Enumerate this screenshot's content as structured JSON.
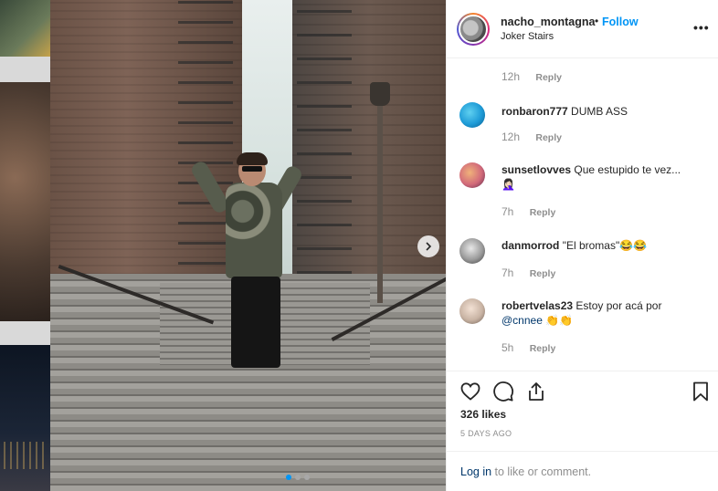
{
  "post": {
    "username": "nacho_montagna",
    "separator": "•",
    "follow_label": "Follow",
    "location": "Joker Stairs",
    "more_label": "•••",
    "likes": "326 likes",
    "date": "5 DAYS AGO",
    "login_link": "Log in",
    "login_suffix": " to like or comment."
  },
  "comments": [
    {
      "time": "12h",
      "reply": "Reply"
    },
    {
      "user": "ronbaron777",
      "text": "DUMB ASS",
      "time": "12h",
      "reply": "Reply",
      "avatar_color": "#1e9bd7"
    },
    {
      "user": "sunsetlovves",
      "text": "Que estupido te vez...",
      "emoji": "🤦🏻‍♀️",
      "time": "7h",
      "reply": "Reply",
      "avatar_color": "#d26a7a"
    },
    {
      "user": "danmorrod",
      "text": "\"El bromas\"😂😂",
      "time": "7h",
      "reply": "Reply",
      "avatar_color": "#9a9a9a"
    },
    {
      "user": "robertvelas23",
      "text": "Estoy por acá por",
      "mention": "@cnnee",
      "emoji": "👏👏",
      "time": "5h",
      "reply": "Reply",
      "avatar_color": "#c9b4a4"
    }
  ],
  "carousel": {
    "count": 3,
    "active": 0
  },
  "icons": [
    "heart-icon",
    "comment-icon",
    "share-icon",
    "bookmark-icon",
    "chevron-right-icon"
  ],
  "colors": {
    "accent": "#0095f6",
    "muted": "#8e8e8e",
    "link": "#00376b"
  }
}
